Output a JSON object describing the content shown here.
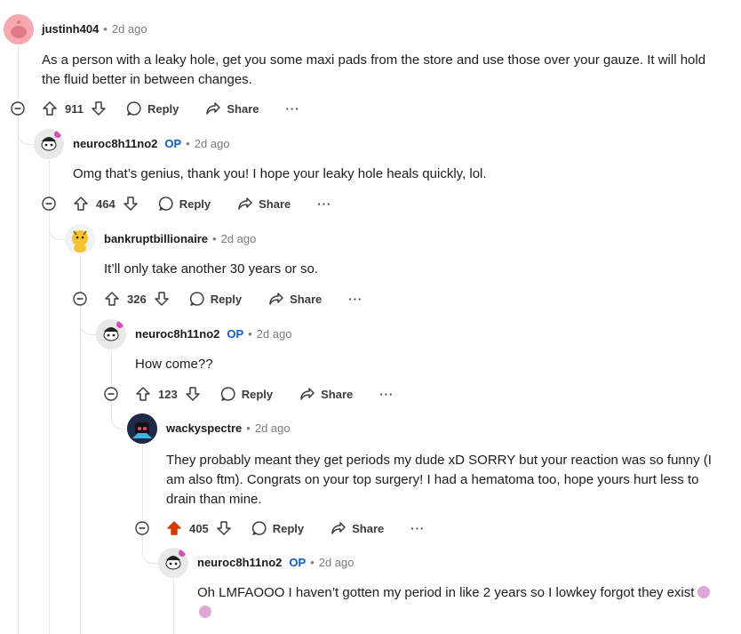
{
  "comments": [
    {
      "username": "justinh404",
      "op": "",
      "time": "2d ago",
      "body": "As a person with a leaky hole, get you some maxi pads from the store and use those over your gauze. It will hold the fluid better in between changes.",
      "score": "911",
      "reply": "Reply",
      "share": "Share",
      "more": "···"
    },
    {
      "username": "neuroc8h11no2",
      "op": "OP",
      "time": "2d ago",
      "body": "Omg that’s genius, thank you! I hope your leaky hole heals quickly, lol.",
      "score": "464",
      "reply": "Reply",
      "share": "Share",
      "more": "···"
    },
    {
      "username": "bankruptbillionaire",
      "op": "",
      "time": "2d ago",
      "body": "It’ll only take another 30 years or so.",
      "score": "326",
      "reply": "Reply",
      "share": "Share",
      "more": "···"
    },
    {
      "username": "neuroc8h11no2",
      "op": "OP",
      "time": "2d ago",
      "body": "How come??",
      "score": "123",
      "reply": "Reply",
      "share": "Share",
      "more": "···"
    },
    {
      "username": "wackyspectre",
      "op": "",
      "time": "2d ago",
      "body": "They probably meant they get periods my dude xD SORRY but your reaction was so funny (I am also ftm). Congrats on your top surgery! I had a hematoma too, hope yours hurt less to drain than mine.",
      "score": "405",
      "reply": "Reply",
      "share": "Share",
      "more": "···"
    },
    {
      "username": "neuroc8h11no2",
      "op": "OP",
      "time": "2d ago",
      "body": "Oh LMFAOOO I haven’t gotten my period in like 2 years so I lowkey forgot they exist",
      "score": "",
      "reply": "",
      "share": "",
      "more": ""
    }
  ],
  "colors": {
    "upvoted": "#d93a00",
    "op": "#0a5fc9",
    "muted": "#7c7c7c"
  }
}
